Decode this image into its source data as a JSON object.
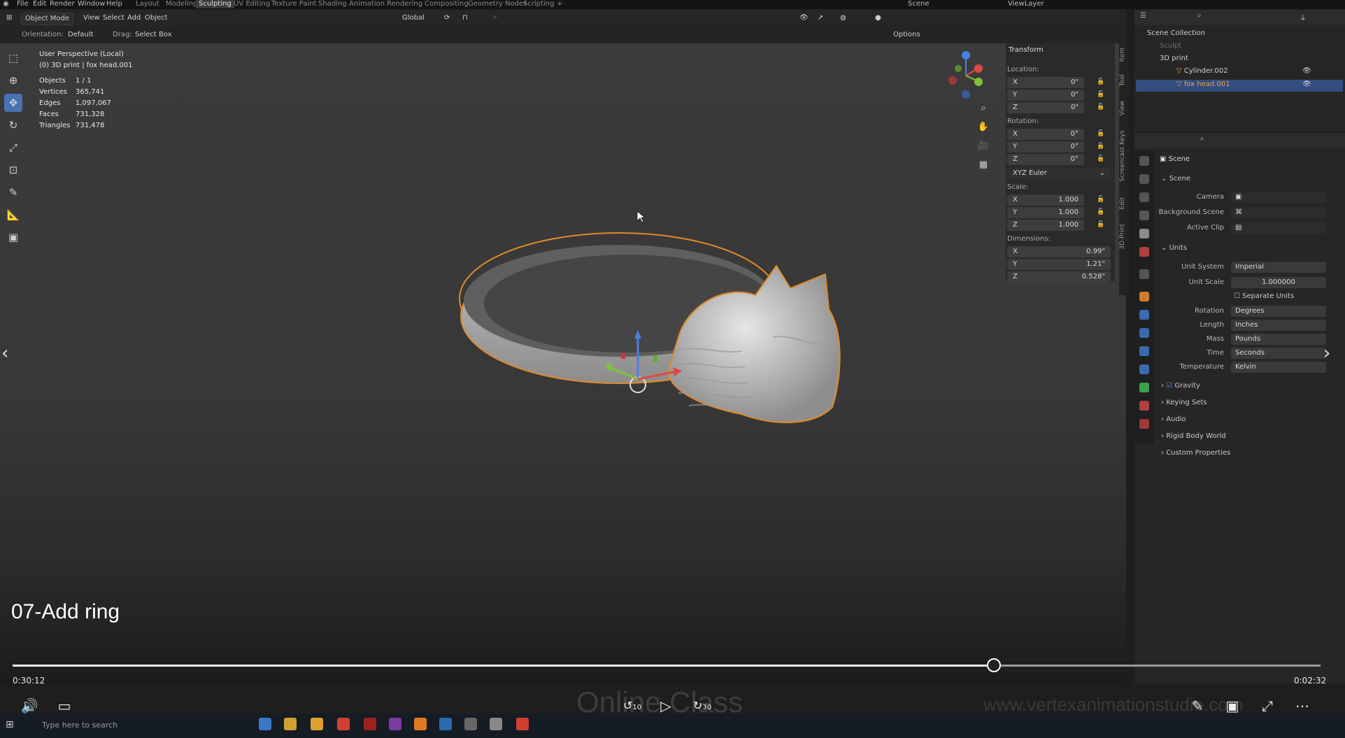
{
  "top_menu": {
    "items": [
      "File",
      "Edit",
      "Render",
      "Window",
      "Help"
    ],
    "workspaces": [
      "Layout",
      "Modeling",
      "Sculpting",
      "UV Editing",
      "Texture Paint",
      "Shading",
      "Animation",
      "Rendering",
      "Compositing",
      "Geometry Nodes",
      "Scripting",
      "+"
    ],
    "active_workspace": "Sculpting",
    "scene_name": "Scene",
    "view_layer": "ViewLayer"
  },
  "header": {
    "mode": "Object Mode",
    "menus": [
      "View",
      "Select",
      "Add",
      "Object"
    ],
    "transform_space": "Global",
    "orientation_label": "Orientation:",
    "orientation_value": "Default",
    "drag_label": "Drag:",
    "drag_value": "Select Box",
    "options": "Options"
  },
  "viewport": {
    "view_name": "User Perspective (Local)",
    "object_info": "(0) 3D print | fox head.001",
    "stats": [
      {
        "label": "Objects",
        "value": "1 / 1"
      },
      {
        "label": "Vertices",
        "value": "365,741"
      },
      {
        "label": "Edges",
        "value": "1,097,067"
      },
      {
        "label": "Faces",
        "value": "731,328"
      },
      {
        "label": "Triangles",
        "value": "731,478"
      }
    ]
  },
  "npanel": {
    "title": "Transform",
    "location_label": "Location:",
    "location": [
      {
        "axis": "X",
        "value": "0\""
      },
      {
        "axis": "Y",
        "value": "0\""
      },
      {
        "axis": "Z",
        "value": "0\""
      }
    ],
    "rotation_label": "Rotation:",
    "rotation": [
      {
        "axis": "X",
        "value": "0°"
      },
      {
        "axis": "Y",
        "value": "0°"
      },
      {
        "axis": "Z",
        "value": "0°"
      }
    ],
    "rotation_mode": "XYZ Euler",
    "scale_label": "Scale:",
    "scale": [
      {
        "axis": "X",
        "value": "1.000"
      },
      {
        "axis": "Y",
        "value": "1.000"
      },
      {
        "axis": "Z",
        "value": "1.000"
      }
    ],
    "dimensions_label": "Dimensions:",
    "dimensions": [
      {
        "axis": "X",
        "value": "0.99\""
      },
      {
        "axis": "Y",
        "value": "1.21\""
      },
      {
        "axis": "Z",
        "value": "0.528\""
      }
    ],
    "tabs": [
      "Item",
      "Tool",
      "View",
      "Screencast Keys",
      "Edit",
      "3D-Print"
    ]
  },
  "outliner": {
    "root": "Scene Collection",
    "items": [
      {
        "name": "Sculpt",
        "level": 1,
        "dim": true
      },
      {
        "name": "3D print",
        "level": 1,
        "dim": false
      },
      {
        "name": "Cylinder.002",
        "level": 2,
        "dim": false
      },
      {
        "name": "fox head.001",
        "level": 2,
        "dim": false,
        "selected": true
      }
    ]
  },
  "properties": {
    "context": "Scene",
    "scene_section": "Scene",
    "camera_label": "Camera",
    "background_scene_label": "Background Scene",
    "active_clip_label": "Active Clip",
    "units_section": "Units",
    "unit_system_label": "Unit System",
    "unit_system": "Imperial",
    "unit_scale_label": "Unit Scale",
    "unit_scale": "1.000000",
    "separate_units": "Separate Units",
    "rotation_label": "Rotation",
    "rotation": "Degrees",
    "length_label": "Length",
    "length": "Inches",
    "mass_label": "Mass",
    "mass": "Pounds",
    "time_label": "Time",
    "time": "Seconds",
    "temperature_label": "Temperature",
    "temperature": "Kelvin",
    "collapsed_sections": [
      "Gravity",
      "Keying Sets",
      "Audio",
      "Rigid Body World",
      "Custom Properties"
    ]
  },
  "video": {
    "lesson_title": "07-Add ring",
    "elapsed": "0:30:12",
    "remaining": "0:02:32",
    "progress": 0.75,
    "skip_back": "10",
    "skip_forward": "30",
    "watermark_center": "Online Class",
    "watermark_right": "www.vertexanimationstudio.com"
  },
  "taskbar": {
    "search_placeholder": "Type here to search"
  }
}
